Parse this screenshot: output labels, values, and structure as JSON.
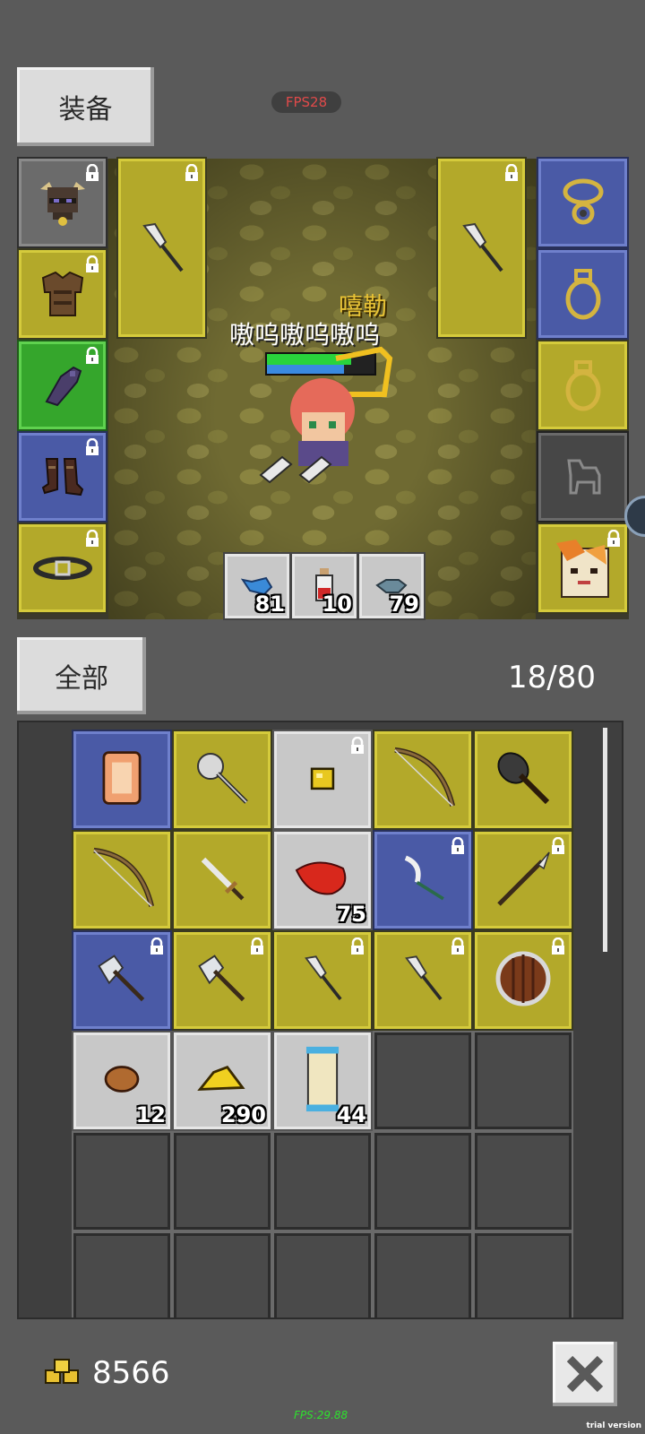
{
  "header": {
    "equip_tab_label": "装备",
    "fps_badge": "FPS28"
  },
  "character": {
    "name": "嘻勒",
    "title": "嗷呜嗷呜嗷呜",
    "hp_fraction": 0.78,
    "mp_fraction": 0.72
  },
  "quick_slots": [
    {
      "icon": "blue-fish-icon",
      "count": "81"
    },
    {
      "icon": "red-potion-icon",
      "count": "10"
    },
    {
      "icon": "gray-fish-icon",
      "count": "79"
    }
  ],
  "inventory": {
    "tab_label": "全部",
    "capacity": "18/80",
    "rows": [
      [
        {
          "icon": "scroll-card-icon",
          "color": "blue",
          "count": "",
          "locked": false
        },
        {
          "icon": "mace-icon",
          "color": "yellow",
          "count": "",
          "locked": false
        },
        {
          "icon": "gold-ore-icon",
          "color": "light",
          "count": "",
          "locked": true
        },
        {
          "icon": "bow-icon",
          "color": "yellow",
          "count": "",
          "locked": false
        },
        {
          "icon": "spiked-club-icon",
          "color": "yellow",
          "count": "",
          "locked": false
        }
      ],
      [
        {
          "icon": "bow-icon",
          "color": "yellow",
          "count": "",
          "locked": false
        },
        {
          "icon": "sword-icon",
          "color": "yellow",
          "count": "",
          "locked": false
        },
        {
          "icon": "raw-meat-icon",
          "color": "light",
          "count": "75",
          "locked": false
        },
        {
          "icon": "sickle-icon",
          "color": "blue",
          "count": "",
          "locked": true
        },
        {
          "icon": "spear-icon",
          "color": "yellow",
          "count": "",
          "locked": true
        }
      ],
      [
        {
          "icon": "axe-icon",
          "color": "blue",
          "count": "",
          "locked": true
        },
        {
          "icon": "axe-icon",
          "color": "yellow",
          "count": "",
          "locked": true
        },
        {
          "icon": "feather-blade-icon",
          "color": "yellow",
          "count": "",
          "locked": true
        },
        {
          "icon": "feather-blade-icon",
          "color": "yellow",
          "count": "",
          "locked": true
        },
        {
          "icon": "round-shield-icon",
          "color": "yellow",
          "count": "",
          "locked": true
        }
      ],
      [
        {
          "icon": "stone-icon",
          "color": "light",
          "count": "12",
          "locked": false
        },
        {
          "icon": "gold-pile-icon",
          "color": "light",
          "count": "290",
          "locked": false
        },
        {
          "icon": "scroll-icon",
          "color": "light",
          "count": "44",
          "locked": false
        },
        {
          "icon": "empty",
          "color": "empty",
          "count": "",
          "locked": false
        },
        {
          "icon": "empty",
          "color": "empty",
          "count": "",
          "locked": false
        }
      ],
      [
        {
          "icon": "empty",
          "color": "empty",
          "count": "",
          "locked": false
        },
        {
          "icon": "empty",
          "color": "empty",
          "count": "",
          "locked": false
        },
        {
          "icon": "empty",
          "color": "empty",
          "count": "",
          "locked": false
        },
        {
          "icon": "empty",
          "color": "empty",
          "count": "",
          "locked": false
        },
        {
          "icon": "empty",
          "color": "empty",
          "count": "",
          "locked": false
        }
      ],
      [
        {
          "icon": "empty",
          "color": "empty",
          "count": "",
          "locked": false
        },
        {
          "icon": "empty",
          "color": "empty",
          "count": "",
          "locked": false
        },
        {
          "icon": "empty",
          "color": "empty",
          "count": "",
          "locked": false
        },
        {
          "icon": "empty",
          "color": "empty",
          "count": "",
          "locked": false
        },
        {
          "icon": "empty",
          "color": "empty",
          "count": "",
          "locked": false
        }
      ]
    ]
  },
  "footer": {
    "gold": "8566",
    "fps": "FPS:29.88",
    "trial": "trial version"
  }
}
